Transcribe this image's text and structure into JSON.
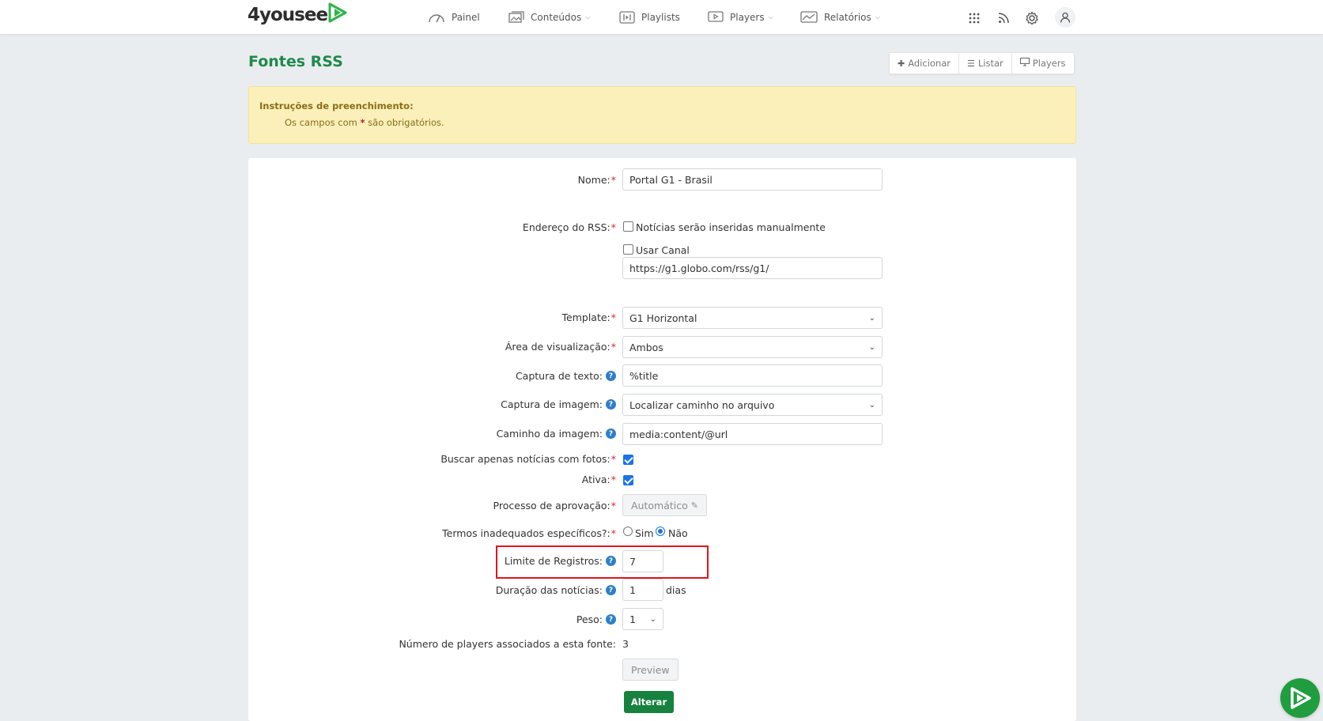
{
  "brand": {
    "name": "4yousee"
  },
  "nav": {
    "items": [
      {
        "label": "Painel",
        "icon": "gauge-icon",
        "caret": false
      },
      {
        "label": "Conteúdos",
        "icon": "images-icon",
        "caret": true
      },
      {
        "label": "Playlists",
        "icon": "playlist-icon",
        "caret": false
      },
      {
        "label": "Players",
        "icon": "player-icon",
        "caret": true
      },
      {
        "label": "Relatórios",
        "icon": "chart-icon",
        "caret": true
      }
    ],
    "right_icons": [
      "apps-grid-icon",
      "rss-icon",
      "gear-icon",
      "user-icon"
    ]
  },
  "page": {
    "title": "Fontes RSS",
    "actions": [
      {
        "label": "Adicionar",
        "icon": "plus-icon"
      },
      {
        "label": "Listar",
        "icon": "list-icon"
      },
      {
        "label": "Players",
        "icon": "monitor-icon"
      }
    ]
  },
  "alert": {
    "title": "Instruções de preenchimento:",
    "text_before": "Os campos com ",
    "star": "*",
    "text_after": " são obrigatórios."
  },
  "form": {
    "nome": {
      "label": "Nome:",
      "value": "Portal G1 - Brasil"
    },
    "endereco": {
      "label": "Endereço do RSS:",
      "check_manual_label": "Notícias serão inseridas manualmente",
      "check_manual": false,
      "check_canal_label": "Usar Canal",
      "check_canal": false,
      "value": "https://g1.globo.com/rss/g1/"
    },
    "template": {
      "label": "Template:",
      "value": "G1 Horizontal"
    },
    "area": {
      "label": "Área de visualização:",
      "value": "Ambos"
    },
    "captura_texto": {
      "label": "Captura de texto:",
      "value": "%title"
    },
    "captura_imagem": {
      "label": "Captura de imagem:",
      "value": "Localizar caminho no arquivo"
    },
    "caminho_imagem": {
      "label": "Caminho da imagem:",
      "value": "media:content/@url"
    },
    "buscar_fotos": {
      "label": "Buscar apenas notícias com fotos:",
      "checked": true
    },
    "ativa": {
      "label": "Ativa:",
      "checked": true
    },
    "aprovacao": {
      "label": "Processo de aprovação:",
      "value": "Automático"
    },
    "termos": {
      "label": "Termos inadequados específicos?:",
      "option_yes": "Sim",
      "option_no": "Não",
      "selected": "Não"
    },
    "limite": {
      "label": "Limite de Registros:",
      "value": "7"
    },
    "duracao": {
      "label": "Duração das notícias:",
      "value": "1",
      "unit": "dias"
    },
    "peso": {
      "label": "Peso:",
      "value": "1"
    },
    "players_assoc": {
      "label": "Número de players associados a esta fonte:",
      "value": "3"
    },
    "preview_label": "Preview",
    "submit_label": "Alterar"
  },
  "colors": {
    "brand_green": "#1e8a4a",
    "required": "#d9232e",
    "help_blue": "#2f7fc9",
    "highlight_red": "#e0161b",
    "alert_bg": "#fbf0ba"
  }
}
